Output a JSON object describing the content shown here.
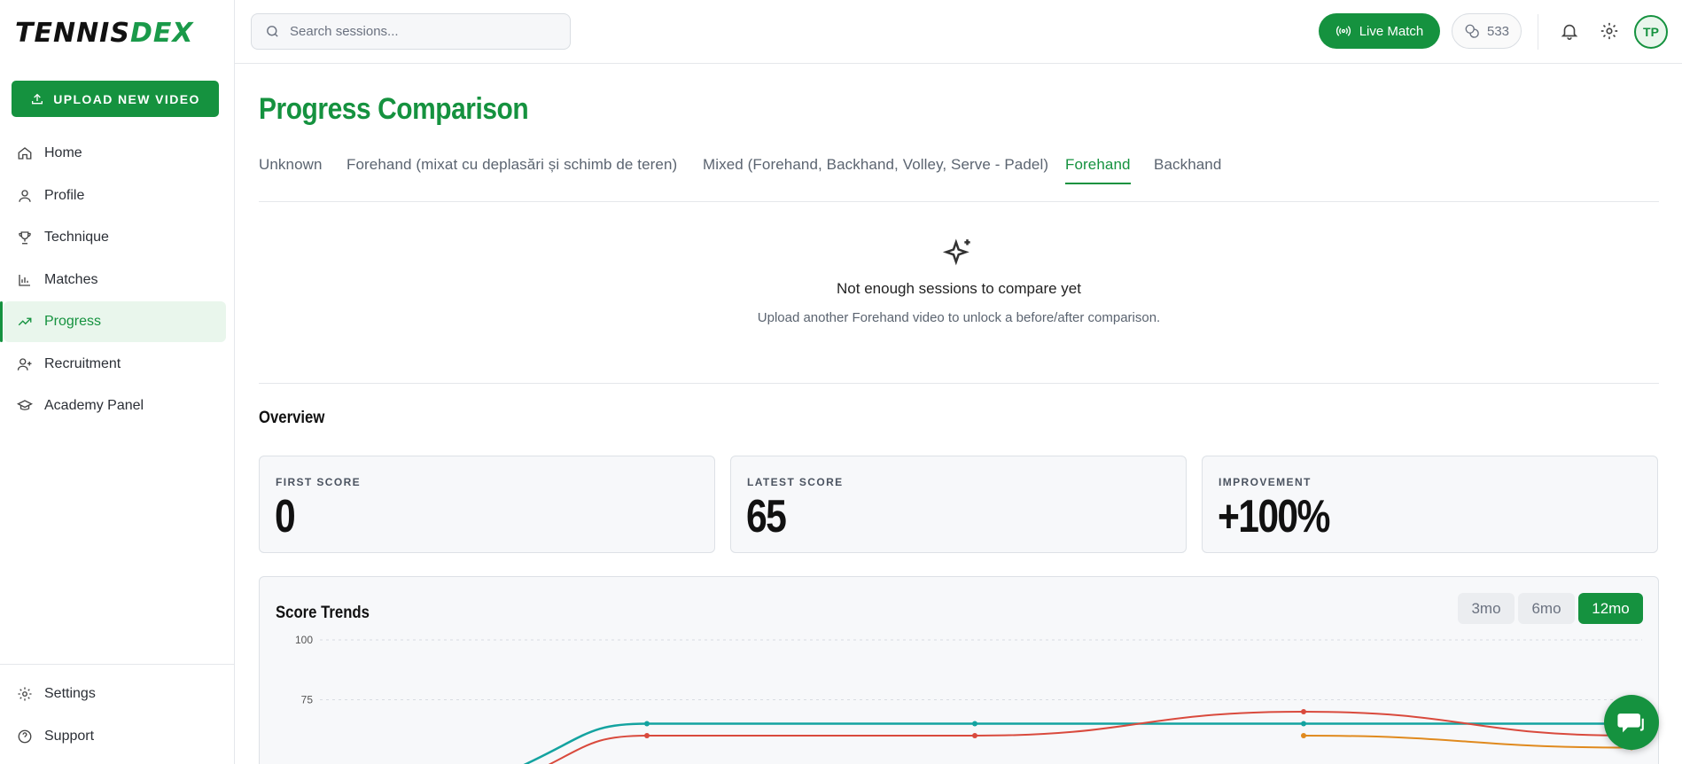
{
  "app": {
    "logo_text": "TENNIS",
    "logo_accent": "DEX",
    "brand_color": "#15923f"
  },
  "sidebar": {
    "upload_label": "UPLOAD NEW VIDEO",
    "items": [
      {
        "label": "Home",
        "icon": "home-icon"
      },
      {
        "label": "Profile",
        "icon": "user-icon"
      },
      {
        "label": "Technique",
        "icon": "trophy-icon"
      },
      {
        "label": "Matches",
        "icon": "bar-chart-icon"
      },
      {
        "label": "Progress",
        "icon": "trending-up-icon",
        "active": true
      },
      {
        "label": "Recruitment",
        "icon": "user-plus-icon"
      },
      {
        "label": "Academy Panel",
        "icon": "graduation-cap-icon"
      }
    ],
    "bottom_items": [
      {
        "label": "Settings",
        "icon": "gear-icon"
      },
      {
        "label": "Support",
        "icon": "help-circle-icon"
      }
    ]
  },
  "header": {
    "search_placeholder": "Search sessions...",
    "live_match_label": "Live Match",
    "credits": "533",
    "avatar_initials": "TP"
  },
  "main": {
    "title": "Progress Comparison",
    "tabs": [
      {
        "label": "Unknown"
      },
      {
        "label": "Forehand (mixat cu deplasări și schimb de teren)"
      },
      {
        "label": "Mixed (Forehand, Backhand, Volley, Serve - Padel)"
      },
      {
        "label": "Forehand",
        "active": true
      },
      {
        "label": "Backhand"
      }
    ],
    "empty_state": {
      "title": "Not enough sessions to compare yet",
      "subtitle": "Upload another Forehand video to unlock a before/after comparison."
    },
    "overview_title": "Overview",
    "stats": [
      {
        "label": "FIRST SCORE",
        "value": "0"
      },
      {
        "label": "LATEST SCORE",
        "value": "65"
      },
      {
        "label": "IMPROVEMENT",
        "value": "+100%"
      }
    ],
    "trends": {
      "title": "Score Trends",
      "ranges": [
        {
          "label": "3mo",
          "active": false
        },
        {
          "label": "6mo",
          "active": false
        },
        {
          "label": "12mo",
          "active": true
        }
      ]
    }
  },
  "chart_data": {
    "type": "line",
    "ylim": [
      0,
      100
    ],
    "yticks": [
      100,
      75
    ],
    "x": [
      0,
      1,
      2,
      3,
      4
    ],
    "series": [
      {
        "color": "#14a3a0",
        "values": [
          null,
          65,
          65,
          65,
          65
        ]
      },
      {
        "color": "#d94a3d",
        "values": [
          null,
          60,
          60,
          70,
          60
        ]
      },
      {
        "color": "#e08a1e",
        "values": [
          null,
          null,
          null,
          60,
          55
        ]
      }
    ],
    "grid": true
  }
}
